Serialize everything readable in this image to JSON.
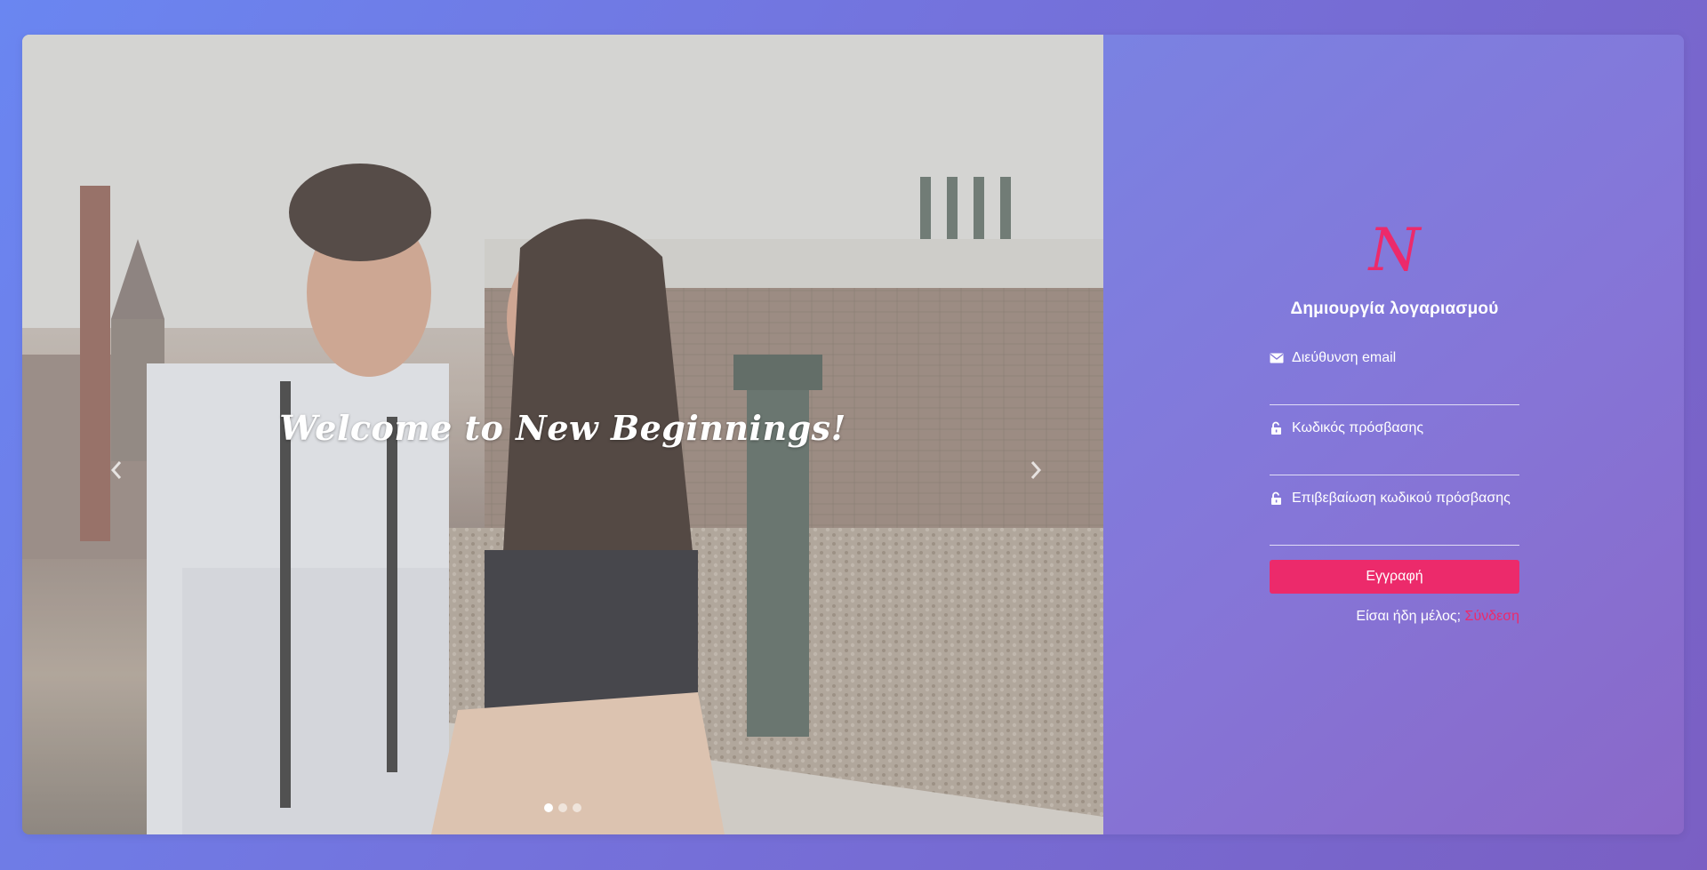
{
  "carousel": {
    "caption": "Welcome to New Beginnings!",
    "slide_count": 3,
    "active_slide": 1,
    "prev_icon": "chevron-left-icon",
    "next_icon": "chevron-right-icon"
  },
  "form": {
    "logo_text": "N",
    "title": "Δημιουργία λογαριασμού",
    "fields": [
      {
        "icon": "envelope-icon",
        "label": "Διεύθυνση email",
        "value": ""
      },
      {
        "icon": "unlock-icon",
        "label": "Κωδικός πρόσβασης",
        "value": ""
      },
      {
        "icon": "unlock-icon",
        "label": "Επιβεβαίωση κωδικού πρόσβασης",
        "value": ""
      }
    ],
    "submit_label": "Εγγραφή",
    "signin_prompt": "Είσαι ήδη μέλος;",
    "signin_link": "Σύνδεση"
  },
  "colors": {
    "accent": "#ec2a6b",
    "background_start": "#6a86f1",
    "background_end": "#7a5fc3"
  }
}
